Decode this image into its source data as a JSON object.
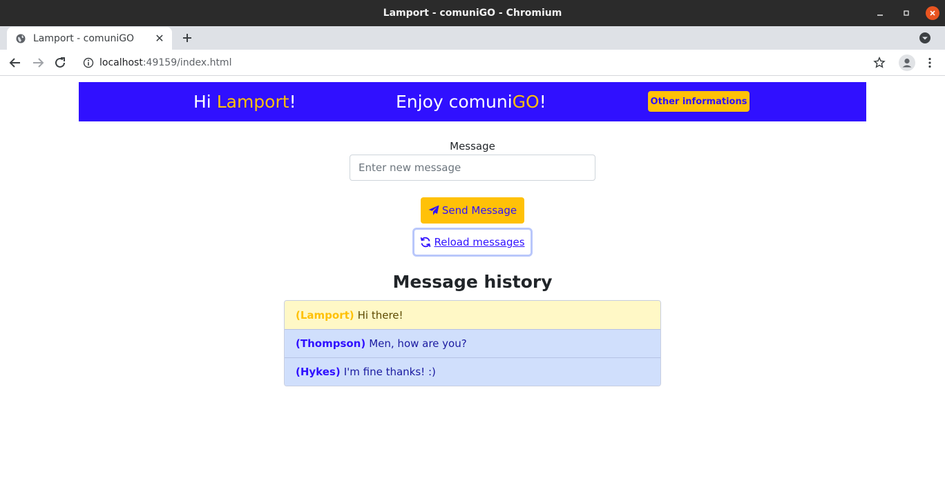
{
  "window": {
    "title": "Lamport - comuniGO - Chromium"
  },
  "tabs": [
    {
      "label": "Lamport - comuniGO",
      "active": true
    }
  ],
  "address_bar": {
    "host": "localhost",
    "rest": ":49159/index.html"
  },
  "banner": {
    "greeting_prefix": "Hi ",
    "username": "Lamport",
    "greeting_suffix": "!",
    "enjoy_prefix": "Enjoy comuni",
    "enjoy_accent": "GO",
    "enjoy_suffix": "!",
    "other_button_label": "Other informations",
    "background_color": "#3010ff",
    "accent_color": "#ffc107"
  },
  "compose": {
    "label": "Message",
    "placeholder": "Enter new message",
    "value": "",
    "send_label": "Send Message",
    "reload_label": "Reload messages"
  },
  "history": {
    "title": "Message history",
    "messages": [
      {
        "author": "(Lamport)",
        "text": "Hi there!",
        "own": true
      },
      {
        "author": "(Thompson)",
        "text": "Men, how are you?",
        "own": false
      },
      {
        "author": "(Hykes)",
        "text": "I'm fine thanks! :)",
        "own": false
      }
    ]
  }
}
